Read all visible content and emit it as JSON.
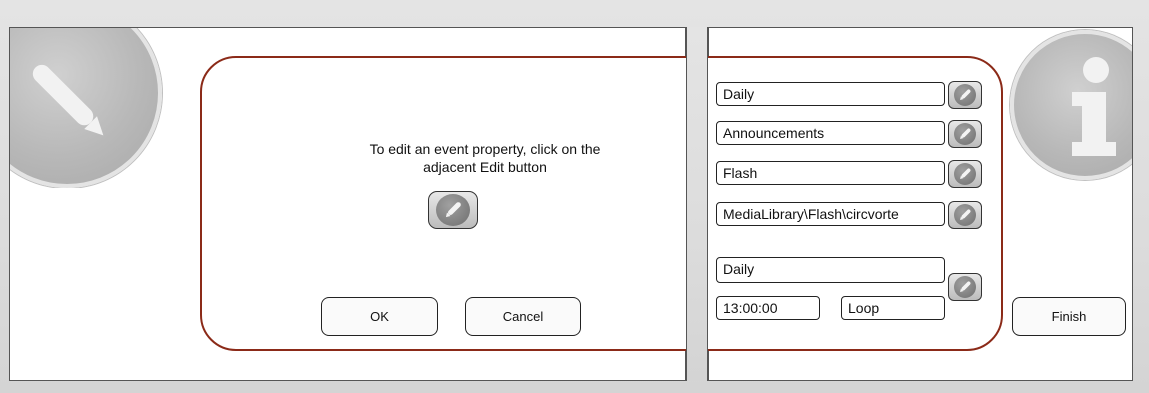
{
  "instruction": {
    "text": "To edit an event property, click on the\nadjacent Edit button"
  },
  "buttons": {
    "ok": "OK",
    "cancel": "Cancel",
    "finish": "Finish"
  },
  "properties": {
    "recurrence": "Daily",
    "category": "Announcements",
    "media_type": "Flash",
    "media_path": "MediaLibrary\\Flash\\circvorte",
    "schedule_frequency": "Daily",
    "start_time": "13:00:00",
    "play_mode": "Loop"
  },
  "icons": {
    "left_decor": "pencil-icon",
    "right_decor": "info-icon",
    "edit": "pencil-icon"
  },
  "colors": {
    "dialog_border": "#8b2a18",
    "icon_gray": "#b8b8b8"
  }
}
